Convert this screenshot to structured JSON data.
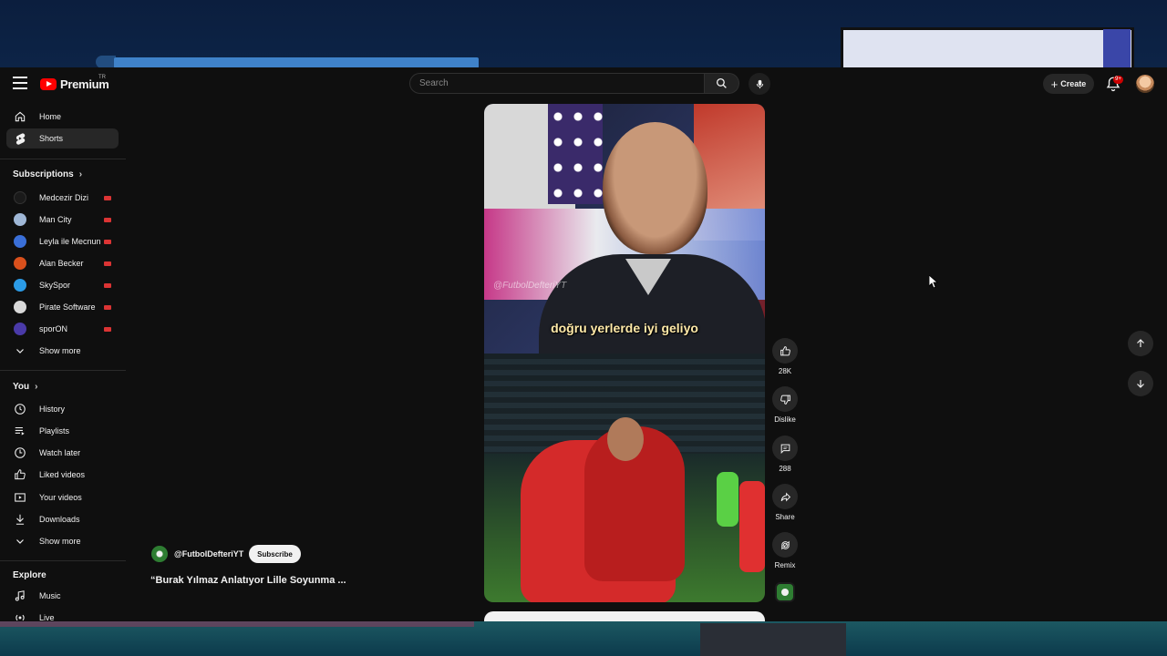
{
  "header": {
    "logo_text": "Premium",
    "logo_region": "TR",
    "search_placeholder": "Search",
    "create_label": "Create",
    "notification_count": "9+"
  },
  "sidebar": {
    "main": [
      {
        "label": "Home",
        "icon": "home-icon"
      },
      {
        "label": "Shorts",
        "icon": "shorts-icon"
      }
    ],
    "subscriptions_title": "Subscriptions",
    "subscriptions": [
      {
        "label": "Medcezir Dizi",
        "color": "#1a1a1a"
      },
      {
        "label": "Man City",
        "color": "#9fb7d6"
      },
      {
        "label": "Leyla ile Mecnun",
        "color": "#3a6fd8"
      },
      {
        "label": "Alan Becker",
        "color": "#d9501c"
      },
      {
        "label": "SkySpor",
        "color": "#2b9be6"
      },
      {
        "label": "Pirate Software",
        "color": "#d9d9d9"
      },
      {
        "label": "sporON",
        "color": "#4a3aa8"
      }
    ],
    "subs_show_more": "Show more",
    "you_title": "You",
    "you_items": [
      {
        "label": "History",
        "icon": "history-icon"
      },
      {
        "label": "Playlists",
        "icon": "playlists-icon"
      },
      {
        "label": "Watch later",
        "icon": "watch-later-icon"
      },
      {
        "label": "Liked videos",
        "icon": "like-icon"
      },
      {
        "label": "Your videos",
        "icon": "your-videos-icon"
      },
      {
        "label": "Downloads",
        "icon": "download-icon"
      }
    ],
    "you_show_more": "Show more",
    "explore_title": "Explore",
    "explore_items": [
      {
        "label": "Music",
        "icon": "music-icon"
      },
      {
        "label": "Live",
        "icon": "live-icon"
      }
    ]
  },
  "short": {
    "watermark": "@FutbolDefteriYT",
    "caption": "doğru yerlerde iyi geliyo",
    "channel": "@FutbolDefteriYT",
    "subscribe_label": "Subscribe",
    "title": "“Burak Yılmaz Anlatıyor Lille Soyunma ..."
  },
  "actions": {
    "like_count": "28K",
    "dislike_label": "Dislike",
    "comment_count": "288",
    "share_label": "Share",
    "remix_label": "Remix"
  }
}
